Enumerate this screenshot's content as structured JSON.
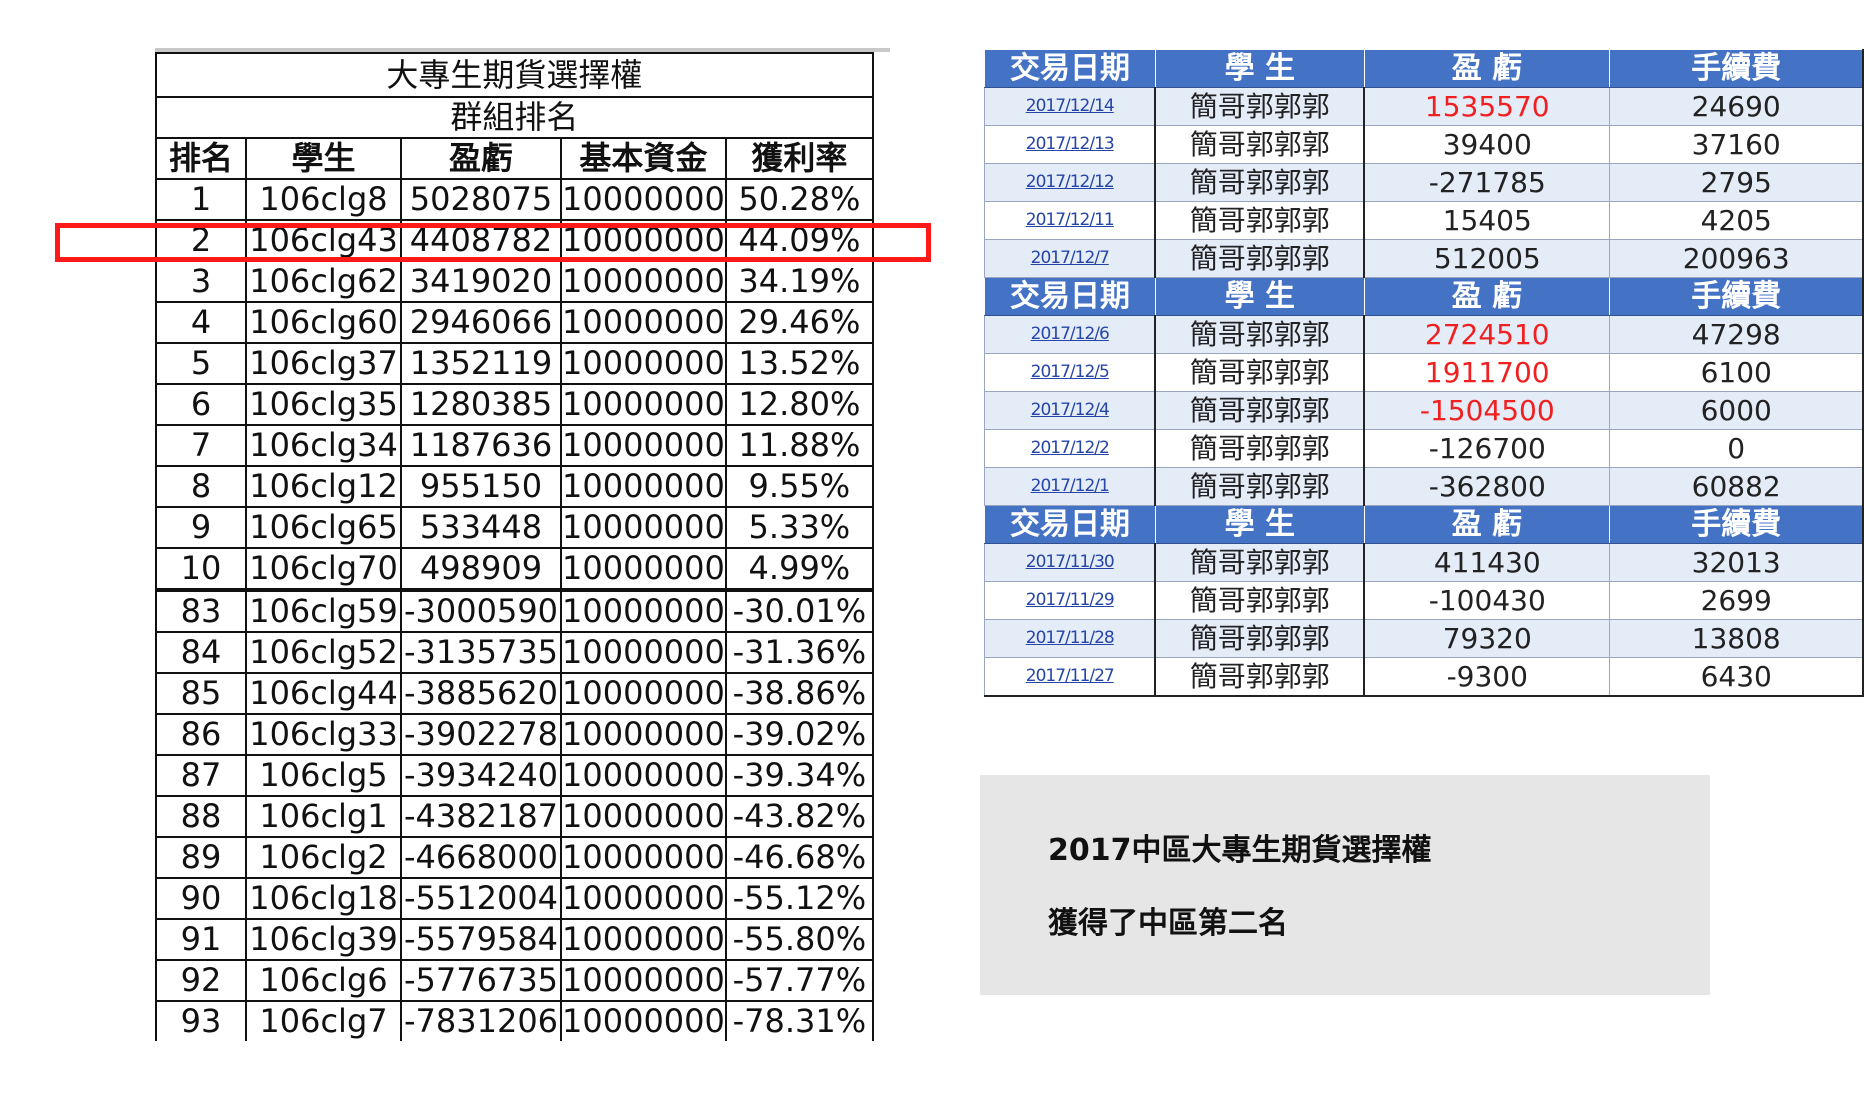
{
  "ranking": {
    "title": "大專生期貨選擇權",
    "subtitle": "群組排名",
    "headers": [
      "排名",
      "學生",
      "盈虧",
      "基本資金",
      "獲利率"
    ],
    "top_rows": [
      [
        "1",
        "106clg8",
        "5028075",
        "10000000",
        "50.28%"
      ],
      [
        "2",
        "106clg43",
        "4408782",
        "10000000",
        "44.09%"
      ],
      [
        "3",
        "106clg62",
        "3419020",
        "10000000",
        "34.19%"
      ],
      [
        "4",
        "106clg60",
        "2946066",
        "10000000",
        "29.46%"
      ],
      [
        "5",
        "106clg37",
        "1352119",
        "10000000",
        "13.52%"
      ],
      [
        "6",
        "106clg35",
        "1280385",
        "10000000",
        "12.80%"
      ],
      [
        "7",
        "106clg34",
        "1187636",
        "10000000",
        "11.88%"
      ],
      [
        "8",
        "106clg12",
        "955150",
        "10000000",
        "9.55%"
      ],
      [
        "9",
        "106clg65",
        "533448",
        "10000000",
        "5.33%"
      ],
      [
        "10",
        "106clg70",
        "498909",
        "10000000",
        "4.99%"
      ]
    ],
    "bottom_rows": [
      [
        "83",
        "106clg59",
        "-3000590",
        "10000000",
        "-30.01%"
      ],
      [
        "84",
        "106clg52",
        "-3135735",
        "10000000",
        "-31.36%"
      ],
      [
        "85",
        "106clg44",
        "-3885620",
        "10000000",
        "-38.86%"
      ],
      [
        "86",
        "106clg33",
        "-3902278",
        "10000000",
        "-39.02%"
      ],
      [
        "87",
        "106clg5",
        "-3934240",
        "10000000",
        "-39.34%"
      ],
      [
        "88",
        "106clg1",
        "-4382187",
        "10000000",
        "-43.82%"
      ],
      [
        "89",
        "106clg2",
        "-4668000",
        "10000000",
        "-46.68%"
      ],
      [
        "90",
        "106clg18",
        "-5512004",
        "10000000",
        "-55.12%"
      ],
      [
        "91",
        "106clg39",
        "-5579584",
        "10000000",
        "-55.80%"
      ],
      [
        "92",
        "106clg6",
        "-5776735",
        "10000000",
        "-57.77%"
      ],
      [
        "93",
        "106clg7",
        "-7831206",
        "10000000",
        "-78.31%"
      ]
    ],
    "highlighted_rank": "2"
  },
  "trades": {
    "headers": [
      "交易日期",
      "學 生",
      "盈 虧",
      "手續費"
    ],
    "groups": [
      {
        "rows": [
          {
            "date": "2017/12/14",
            "student": "簡哥郭郭郭",
            "pl": "1535570",
            "fee": "24690",
            "pl_red": true
          },
          {
            "date": "2017/12/13",
            "student": "簡哥郭郭郭",
            "pl": "39400",
            "fee": "37160",
            "pl_red": false
          },
          {
            "date": "2017/12/12",
            "student": "簡哥郭郭郭",
            "pl": "-271785",
            "fee": "2795",
            "pl_red": false
          },
          {
            "date": "2017/12/11",
            "student": "簡哥郭郭郭",
            "pl": "15405",
            "fee": "4205",
            "pl_red": false
          },
          {
            "date": "2017/12/7",
            "student": "簡哥郭郭郭",
            "pl": "512005",
            "fee": "200963",
            "pl_red": false
          }
        ]
      },
      {
        "rows": [
          {
            "date": "2017/12/6",
            "student": "簡哥郭郭郭",
            "pl": "2724510",
            "fee": "47298",
            "pl_red": true
          },
          {
            "date": "2017/12/5",
            "student": "簡哥郭郭郭",
            "pl": "1911700",
            "fee": "6100",
            "pl_red": true
          },
          {
            "date": "2017/12/4",
            "student": "簡哥郭郭郭",
            "pl": "-1504500",
            "fee": "6000",
            "pl_red": true
          },
          {
            "date": "2017/12/2",
            "student": "簡哥郭郭郭",
            "pl": "-126700",
            "fee": "0",
            "pl_red": false
          },
          {
            "date": "2017/12/1",
            "student": "簡哥郭郭郭",
            "pl": "-362800",
            "fee": "60882",
            "pl_red": false
          }
        ]
      },
      {
        "rows": [
          {
            "date": "2017/11/30",
            "student": "簡哥郭郭郭",
            "pl": "411430",
            "fee": "32013",
            "pl_red": false
          },
          {
            "date": "2017/11/29",
            "student": "簡哥郭郭郭",
            "pl": "-100430",
            "fee": "2699",
            "pl_red": false
          },
          {
            "date": "2017/11/28",
            "student": "簡哥郭郭郭",
            "pl": "79320",
            "fee": "13808",
            "pl_red": false
          },
          {
            "date": "2017/11/27",
            "student": "簡哥郭郭郭",
            "pl": "-9300",
            "fee": "6430",
            "pl_red": false
          }
        ]
      }
    ]
  },
  "note": {
    "line1": "2017中區大專生期貨選擇權",
    "line2": "獲得了中區第二名"
  },
  "colors": {
    "header_blue": "#4472c4",
    "highlight_red": "#ff1a1a",
    "profit_red": "#f02020",
    "link_blue": "#2645a8",
    "note_bg": "#e6e6e6"
  }
}
